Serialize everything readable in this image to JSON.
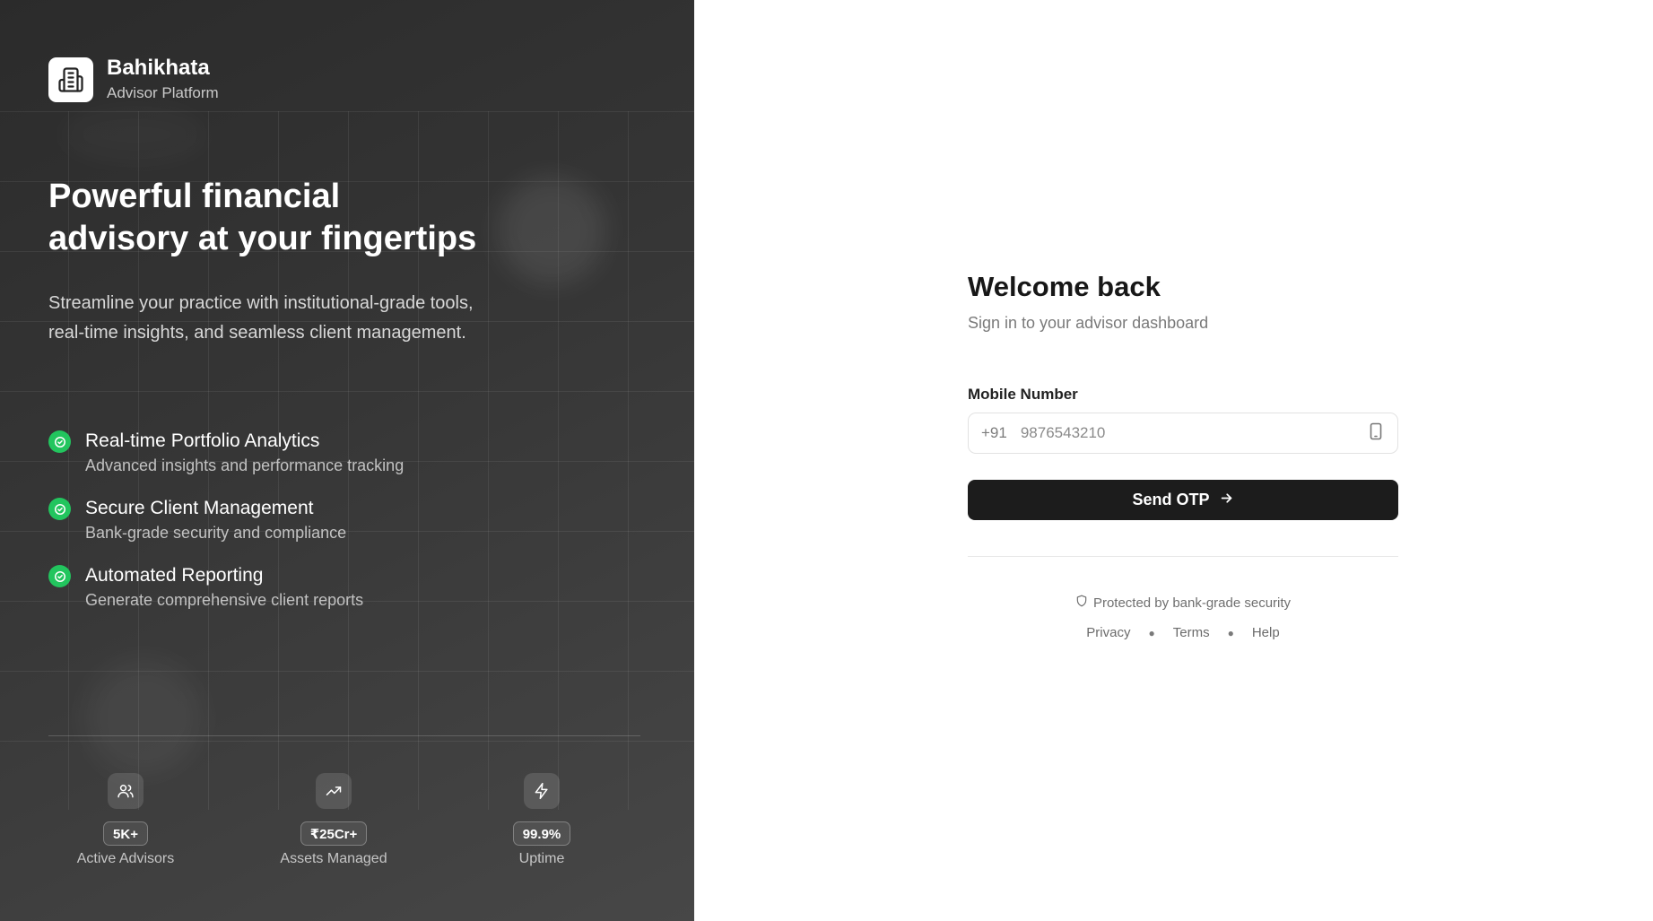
{
  "brand": {
    "name": "Bahikhata",
    "subtitle": "Advisor Platform"
  },
  "hero": {
    "headline_line1": "Powerful financial",
    "headline_line2": "advisory at your fingertips",
    "description": "Streamline your practice with institutional-grade tools, real-time insights, and seamless client management."
  },
  "features": [
    {
      "title": "Real-time Portfolio Analytics",
      "description": "Advanced insights and performance tracking"
    },
    {
      "title": "Secure Client Management",
      "description": "Bank-grade security and compliance"
    },
    {
      "title": "Automated Reporting",
      "description": "Generate comprehensive client reports"
    }
  ],
  "stats": [
    {
      "icon": "users-icon",
      "value": "5K+",
      "label": "Active Advisors"
    },
    {
      "icon": "trending-up-icon",
      "value": "₹25Cr+",
      "label": "Assets Managed"
    },
    {
      "icon": "lightning-icon",
      "value": "99.9%",
      "label": "Uptime"
    }
  ],
  "signin": {
    "title": "Welcome back",
    "subtitle": "Sign in to your advisor dashboard",
    "mobile_label": "Mobile Number",
    "country_code": "+91",
    "mobile_placeholder": "9876543210",
    "mobile_value": "",
    "send_otp_label": "Send OTP",
    "security_note": "Protected by bank-grade security"
  },
  "footer_links": {
    "privacy": "Privacy",
    "terms": "Terms",
    "help": "Help"
  },
  "colors": {
    "left_panel_dark": "#2b2b2b",
    "accent_green": "#22c55e",
    "button_dark": "#1c1c1c"
  }
}
